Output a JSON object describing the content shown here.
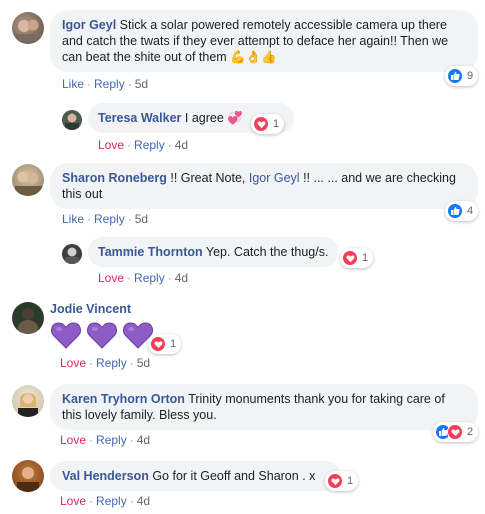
{
  "comments": [
    {
      "author": "Igor Geyl",
      "text_lines": [
        "Stick a solar powered remotely accessible camera up there",
        "and catch the twats if they ever attempt to deface her again!! Then we",
        "can beat the shite out of them"
      ],
      "emoji": "💪👌👍",
      "action_primary": "Like",
      "reply": "Reply",
      "time": "5d",
      "reaction_count": "9"
    },
    {
      "author": "Teresa Walker",
      "text": "I agree",
      "emoji": "💞",
      "action_primary": "Love",
      "reply": "Reply",
      "time": "4d",
      "reaction_count": "1"
    },
    {
      "author": "Sharon Roneberg",
      "text_before": "!! Great Note, ",
      "mention": "Igor Geyl",
      "text_after": " !! ... ... and we are checking",
      "text_line2": "this out",
      "action_primary": "Like",
      "reply": "Reply",
      "time": "5d",
      "reaction_count": "4"
    },
    {
      "author": "Tammie Thornton",
      "text": "Yep. Catch the thug/s.",
      "action_primary": "Love",
      "reply": "Reply",
      "time": "4d",
      "reaction_count": "1"
    },
    {
      "author": "Jodie Vincent",
      "action_primary": "Love",
      "reply": "Reply",
      "time": "5d",
      "reaction_count": "1"
    },
    {
      "author": "Karen Tryhorn Orton",
      "text_lines": [
        "Trinity monuments thank you for taking care of",
        "this lovely family. Bless you."
      ],
      "action_primary": "Love",
      "reply": "Reply",
      "time": "4d",
      "reaction_count": "2"
    },
    {
      "author": "Val Henderson",
      "text": "Go for it Geoff and Sharon . x",
      "action_primary": "Love",
      "reply": "Reply",
      "time": "4d",
      "reaction_count": "1"
    }
  ],
  "separator": "·",
  "colors": {
    "author": "#385898",
    "action_link": "#4267b2",
    "love": "#e0245e",
    "bubble_bg": "#f2f3f5",
    "like_blue": "#1877f2",
    "heart_red": "#f33e58",
    "purple_heart": "#8e5cc7"
  }
}
